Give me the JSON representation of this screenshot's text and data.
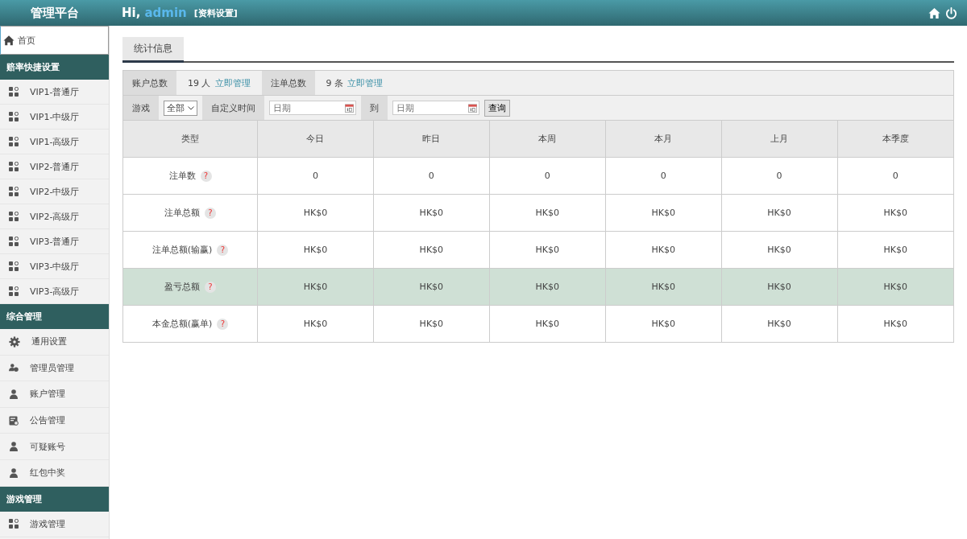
{
  "header": {
    "brand": "管理平台",
    "greeting": "Hi,",
    "user": "admin",
    "profile_link": "[资料设置]"
  },
  "sidebar": {
    "home": {
      "label": "首页",
      "selected": true
    },
    "sections": [
      {
        "title": "赔率快捷设置",
        "items": [
          {
            "label": "VIP1-普通厅",
            "kind": "apps"
          },
          {
            "label": "VIP1-中级厅",
            "kind": "apps"
          },
          {
            "label": "VIP1-高级厅",
            "kind": "apps"
          },
          {
            "label": "VIP2-普通厅",
            "kind": "apps"
          },
          {
            "label": "VIP2-中级厅",
            "kind": "apps"
          },
          {
            "label": "VIP2-高级厅",
            "kind": "apps"
          },
          {
            "label": "VIP3-普通厅",
            "kind": "apps"
          },
          {
            "label": "VIP3-中级厅",
            "kind": "apps"
          },
          {
            "label": "VIP3-高级厅",
            "kind": "apps"
          }
        ]
      },
      {
        "title": "综合管理",
        "items": [
          {
            "label": "通用设置",
            "kind": "gear"
          },
          {
            "label": "管理员管理",
            "kind": "users"
          },
          {
            "label": "账户管理",
            "kind": "user"
          },
          {
            "label": "公告管理",
            "kind": "notice"
          },
          {
            "label": "可疑账号",
            "kind": "user"
          },
          {
            "label": "红包中奖",
            "kind": "user"
          }
        ]
      },
      {
        "title": "游戏管理",
        "items": [
          {
            "label": "游戏管理",
            "kind": "apps"
          }
        ]
      }
    ]
  },
  "tabs": [
    {
      "label": "统计信息",
      "selected": true
    }
  ],
  "summary": [
    {
      "label": "账户总数",
      "value": "19 人",
      "link": "立即管理"
    },
    {
      "label": "注单总数",
      "value": "9 条",
      "link": "立即管理"
    }
  ],
  "filter": {
    "game_label": "游戏",
    "game_value": "全部",
    "time_label": "自定义时间",
    "from_placeholder": "日期",
    "to_label": "到",
    "to_placeholder": "日期",
    "query_button": "查询"
  },
  "table": {
    "columns": [
      "类型",
      "今日",
      "昨日",
      "本周",
      "本月",
      "上月",
      "本季度"
    ],
    "rows": [
      {
        "highlighted": false,
        "cells": [
          "注单数",
          "0",
          "0",
          "0",
          "0",
          "0",
          "0"
        ]
      },
      {
        "highlighted": false,
        "cells": [
          "注单总额",
          "HK$0",
          "HK$0",
          "HK$0",
          "HK$0",
          "HK$0",
          "HK$0"
        ]
      },
      {
        "highlighted": false,
        "cells": [
          "注单总额(输赢)",
          "HK$0",
          "HK$0",
          "HK$0",
          "HK$0",
          "HK$0",
          "HK$0"
        ]
      },
      {
        "highlighted": true,
        "cells": [
          "盈亏总额",
          "HK$0",
          "HK$0",
          "HK$0",
          "HK$0",
          "HK$0",
          "HK$0"
        ]
      },
      {
        "highlighted": false,
        "cells": [
          "本金总额(赢单)",
          "HK$0",
          "HK$0",
          "HK$0",
          "HK$0",
          "HK$0",
          "HK$0"
        ]
      }
    ],
    "help_mark": "?"
  }
}
